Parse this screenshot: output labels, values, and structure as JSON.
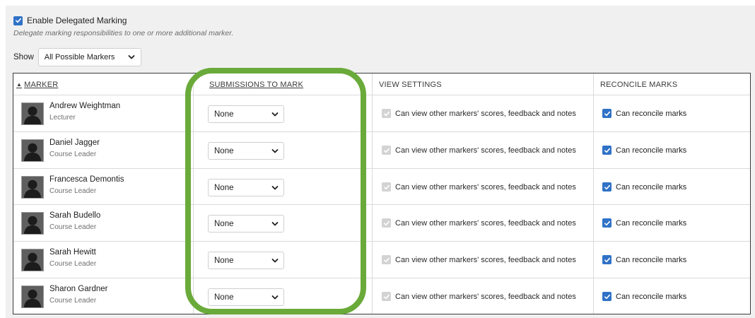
{
  "delegated_marking": {
    "enable_label": "Enable Delegated Marking",
    "enabled": true,
    "hint": "Delegate marking responsibilities to one or more additional marker."
  },
  "show_filter": {
    "label": "Show",
    "selected": "All Possible Markers"
  },
  "table": {
    "headers": {
      "marker": "MARKER",
      "submissions": "SUBMISSIONS TO MARK",
      "view_settings": "VIEW SETTINGS",
      "reconcile": "RECONCILE MARKS"
    },
    "sort_indicator": "▲",
    "view_setting_label": "Can view other markers' scores, feedback and notes",
    "reconcile_label": "Can reconcile marks",
    "rows": [
      {
        "name": "Andrew Weightman",
        "role": "Lecturer",
        "submissions": "None",
        "view_checked": true,
        "view_disabled": true,
        "reconcile_checked": true
      },
      {
        "name": "Daniel Jagger",
        "role": "Course Leader",
        "submissions": "None",
        "view_checked": true,
        "view_disabled": true,
        "reconcile_checked": true
      },
      {
        "name": "Francesca Demontis",
        "role": "Course Leader",
        "submissions": "None",
        "view_checked": true,
        "view_disabled": true,
        "reconcile_checked": true
      },
      {
        "name": "Sarah Budello",
        "role": "Course Leader",
        "submissions": "None",
        "view_checked": true,
        "view_disabled": true,
        "reconcile_checked": true
      },
      {
        "name": "Sarah Hewitt",
        "role": "Course Leader",
        "submissions": "None",
        "view_checked": true,
        "view_disabled": true,
        "reconcile_checked": true
      },
      {
        "name": "Sharon Gardner",
        "role": "Course Leader",
        "submissions": "None",
        "view_checked": true,
        "view_disabled": true,
        "reconcile_checked": true
      }
    ]
  },
  "colors": {
    "checkbox_checked": "#2f72c7",
    "checkbox_disabled": "#d3d3d3",
    "highlight_outline": "#6aaa3a"
  },
  "icons": {
    "checkbox": "check-icon",
    "select": "chevron-down-icon",
    "avatar": "user-silhouette-icon",
    "sort": "sort-ascending-icon"
  }
}
